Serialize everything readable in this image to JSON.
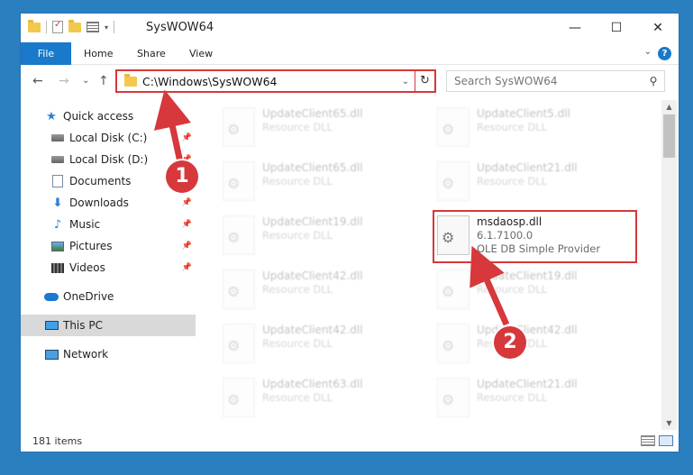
{
  "window": {
    "title": "SysWOW64",
    "controls": {
      "minimize": "—",
      "maximize": "☐",
      "close": "✕"
    }
  },
  "ribbon": {
    "tabs": [
      "File",
      "Home",
      "Share",
      "View"
    ],
    "help": "?"
  },
  "navigation": {
    "back": "←",
    "forward": "→",
    "recent": "⌄",
    "up": "↑",
    "address": "C:\\Windows\\SysWOW64",
    "refresh": "↻",
    "search_placeholder": "Search SysWOW64"
  },
  "sidebar": {
    "items": [
      {
        "label": "Quick access",
        "icon": "star-icon",
        "pinned": false
      },
      {
        "label": "Local Disk (C:)",
        "icon": "drive-icon",
        "pinned": true
      },
      {
        "label": "Local Disk (D:)",
        "icon": "drive-icon",
        "pinned": true
      },
      {
        "label": "Documents",
        "icon": "documents-icon",
        "pinned": true
      },
      {
        "label": "Downloads",
        "icon": "download-icon",
        "pinned": true
      },
      {
        "label": "Music",
        "icon": "music-icon",
        "pinned": true
      },
      {
        "label": "Pictures",
        "icon": "pictures-icon",
        "pinned": true
      },
      {
        "label": "Videos",
        "icon": "videos-icon",
        "pinned": true
      },
      {
        "label": "OneDrive",
        "icon": "onedrive-icon",
        "pinned": false
      },
      {
        "label": "This PC",
        "icon": "pc-icon",
        "pinned": false,
        "selected": true
      },
      {
        "label": "Network",
        "icon": "network-icon",
        "pinned": false
      }
    ]
  },
  "files": [
    {
      "name": "UpdateClient65.dll",
      "type": "Resource DLL"
    },
    {
      "name": "UpdateClient5.dll",
      "type": "Resource DLL"
    },
    {
      "name": "UpdateClient65.dll",
      "type": "Resource DLL"
    },
    {
      "name": "UpdateClient21.dll",
      "type": "Resource DLL"
    },
    {
      "name": "UpdateClient19.dll",
      "type": "Resource DLL"
    },
    {
      "name": "msdaosp.dll",
      "version": "6.1.7100.0",
      "type": "OLE DB Simple Provider",
      "highlighted": true
    },
    {
      "name": "UpdateClient42.dll",
      "type": "Resource DLL"
    },
    {
      "name": "UpdateClient19.dll",
      "type": "Resource DLL"
    },
    {
      "name": "UpdateClient42.dll",
      "type": "Resource DLL"
    },
    {
      "name": "UpdateClient42.dll",
      "type": "Resource DLL"
    },
    {
      "name": "UpdateClient63.dll",
      "type": "Resource DLL"
    },
    {
      "name": "UpdateClient21.dll",
      "type": "Resource DLL"
    }
  ],
  "status": {
    "item_count": "181 items"
  },
  "callouts": {
    "one": "1",
    "two": "2"
  },
  "colors": {
    "accent": "#1979ca",
    "highlight": "#d6383b"
  }
}
